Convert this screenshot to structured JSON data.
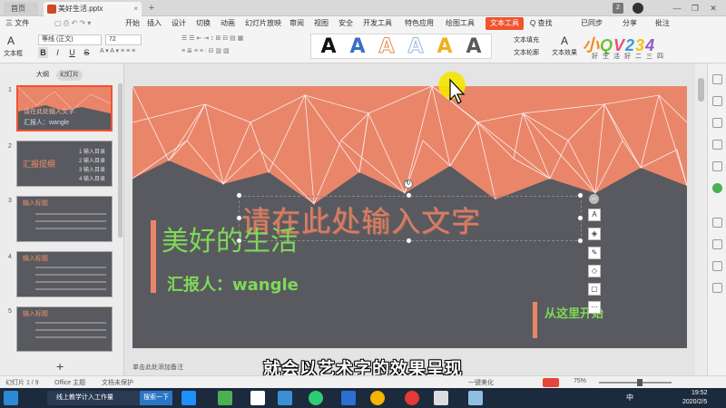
{
  "titlebar": {
    "home_tab": "首页",
    "doc_tab": "美好生活.pptx",
    "tab_close": "×",
    "new_tab": "+",
    "badge": "2",
    "minimize": "—",
    "maximize": "❐",
    "close": "✕"
  },
  "menubar": {
    "file": "三 文件",
    "items": [
      "开始",
      "插入",
      "设计",
      "切换",
      "动画",
      "幻灯片放映",
      "审阅",
      "视图",
      "安全",
      "开发工具",
      "特色应用",
      "绘图工具"
    ],
    "active": "文本工具",
    "search": "Q 查找",
    "sync": "已同步",
    "share": "分享",
    "annotate": "批注"
  },
  "ribbon": {
    "text_box": "文本框",
    "font_name": "等线 (正文)",
    "font_size": "72",
    "bold": "B",
    "italic": "I",
    "underline": "U",
    "strike": "S",
    "text_fill": "文本填充",
    "text_outline": "文本轮廓",
    "text_effect": "文本效果",
    "art_letters": [
      "A",
      "A",
      "A",
      "A",
      "A",
      "A"
    ],
    "art_colors": [
      "#111111",
      "#3b6fc4",
      "#e58a4e",
      "#9ab6da",
      "#f0b021",
      "#5a5a5a"
    ]
  },
  "logo": {
    "text": "小QV234",
    "subtitle": "好生活好二三四",
    "colors": [
      "#f08a1a",
      "#6fbf3a",
      "#e94e77",
      "#3a9bd6",
      "#f2c21a",
      "#8e5bc5"
    ]
  },
  "leftpanel": {
    "tab_outline": "大纲",
    "tab_slides": "幻灯片",
    "thumbs": [
      {
        "num": "1",
        "title": "请在此处输入文字",
        "sub": "汇报人：wangle"
      },
      {
        "num": "2",
        "title": "汇报提纲",
        "items": [
          "1 输入目录",
          "2 输入目录",
          "3 输入目录",
          "4 输入目录"
        ]
      },
      {
        "num": "3",
        "title": "输入标题"
      },
      {
        "num": "4",
        "title": "输入标题"
      },
      {
        "num": "5",
        "title": "输入标题"
      }
    ],
    "add": "+"
  },
  "slide": {
    "wordart": "请在此处输入文字",
    "title": "美好的生活",
    "reporter": "汇报人：wangle",
    "footer": "从这里开始",
    "accent": "#e9866a",
    "green": "#7ed957",
    "bg": "#595a60"
  },
  "notes_placeholder": "单击此处添加备注",
  "statusbar": {
    "slide_pos": "幻灯片 1 / 9",
    "theme": "Office 主题",
    "protect": "文档未保护",
    "beautify": "一键美化",
    "zoom": "75%"
  },
  "taskbar": {
    "app_label": "线上教学计入工作量",
    "search": "搜索一下",
    "lang": "中",
    "time": "19:52",
    "date": "2020/2/5"
  },
  "subtitle": "就会以艺术字的效果呈现"
}
